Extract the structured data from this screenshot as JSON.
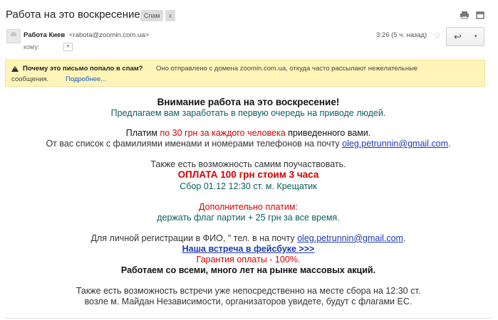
{
  "header": {
    "subject": "Работа на это воскресение",
    "spam_label": "Спам",
    "spam_close": "x",
    "print_icon": "print-icon",
    "newwin_icon": "new-window-icon"
  },
  "sender": {
    "name": "Работа Киев",
    "email": "<rabota@zoomin.com.ua>",
    "to_label": "кому:",
    "time": "3:26 (5 ч. назад)",
    "star": "☆",
    "reply": "↩",
    "more": "▾"
  },
  "warning": {
    "question": "Почему это письмо попало в спам?",
    "text": "Оно отправлено с домена zoomin.com.ua, откуда часто рассылают нежелательные",
    "line2": "сообщения.",
    "more": "Подробнее..."
  },
  "body": {
    "title": "Внимание работа на это воскресение!",
    "l2": "Предлагаем вам заработать в первую очередь на приводе людей.",
    "l3a": "Платим ",
    "l3b": "по 30 грн за каждого человека",
    "l3c": " приведенного вами.",
    "l4a": "От вас список с фамилиями именами и номерами телефонов на почту ",
    "l4link": "oleg.petrunnin@gmail.com",
    "l4c": ".",
    "l5": "Также есть возможность самим поучаствовать.",
    "l6": "ОПЛАТА 100 грн стоим 3 часа",
    "l7": "Сбор 01.12 12:30 ст. м. Крещатик",
    "l8": "Дополнительно платим:",
    "l9": "держать флаг партии + 25 грн за все время.",
    "l10a": "Для личной регистрации в ФИО, \" тел. в на почту ",
    "l10link": "oleg.petrunnin@gmail.com",
    "l10c": ".",
    "l11": "Наша встреча в фейсбуке >>>",
    "l12": "Гарантия оплаты - 100%.",
    "l13": "Работаем со всеми, много лет на рынке массовых акций.",
    "l14": "Также есть возможность встречи уже непосредственно на месте сбора на 12:30 ст.",
    "l15": "возле м. Майдан Независимости, организаторов увидете, будут с флагами ЕС."
  }
}
